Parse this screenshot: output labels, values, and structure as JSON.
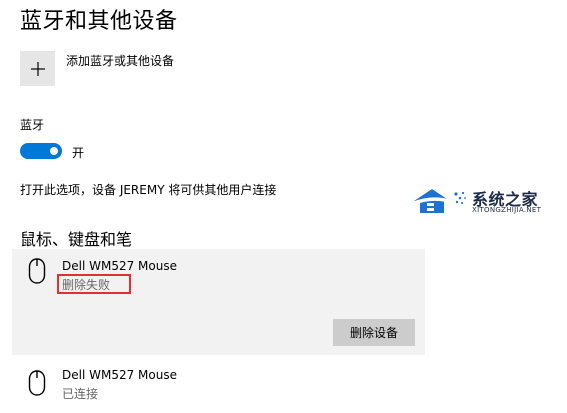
{
  "page": {
    "title": "蓝牙和其他设备"
  },
  "add_device": {
    "icon": "plus-icon",
    "label": "添加蓝牙或其他设备"
  },
  "bluetooth": {
    "label": "蓝牙",
    "toggle_on": true,
    "toggle_state": "开",
    "discoverable_text": "打开此选项，设备 JEREMY 将可供其他用户连接"
  },
  "peripherals": {
    "title": "鼠标、键盘和笔",
    "devices": [
      {
        "name": "Dell WM527 Mouse",
        "status": "删除失败",
        "icon": "mouse-icon",
        "expanded": true,
        "remove_label": "删除设备"
      },
      {
        "name": "Dell WM527 Mouse",
        "status": "已连接",
        "icon": "mouse-icon",
        "expanded": false
      }
    ]
  },
  "watermark": {
    "name": "系统之家",
    "url": "XITONGZHIJIA.NET"
  },
  "colors": {
    "accent": "#0078d7",
    "card_background": "#f2f2f2",
    "highlight_border": "#e03030",
    "button_background": "#cccccc"
  }
}
